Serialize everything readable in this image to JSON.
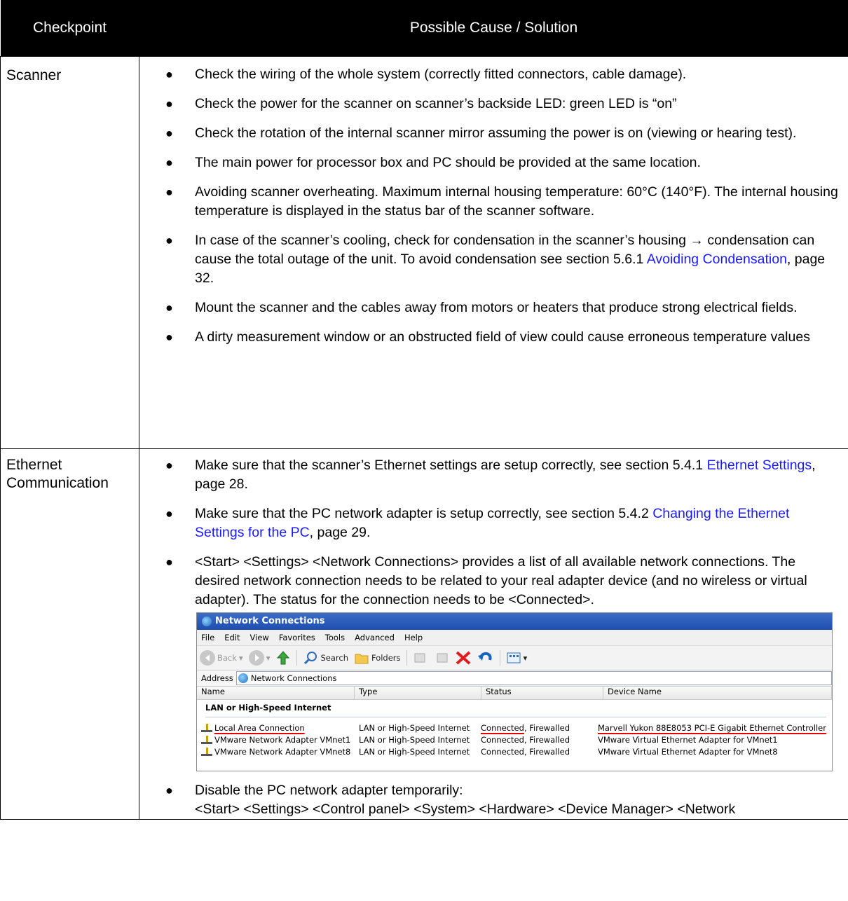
{
  "table": {
    "headers": {
      "checkpoint": "Checkpoint",
      "solution": "Possible Cause / Solution"
    },
    "scanner": {
      "label": "Scanner",
      "bullets": [
        "Check the wiring of the whole system (correctly fitted connectors, cable damage).",
        "Check the power for the scanner on scanner’s backside LED: green LED is “on”",
        "Check the rotation of the internal scanner mirror assuming the power is on (viewing or hearing test).",
        "The main power for processor box and PC should be provided at the same location.",
        "Avoiding scanner overheating. Maximum internal housing temperature: 60°C (140°F). The internal housing temperature is displayed in the status bar of the scanner software."
      ],
      "condensation": {
        "pre": "In case of the scanner’s cooling, check for condensation in the scanner’s housing → condensation can cause the total outage of the unit. To avoid condensation see section 5.6.1 ",
        "link": "Avoiding Condensation",
        "post": ", page 32."
      },
      "bullets2": [
        "Mount the scanner and the cables away from motors or heaters that produce strong electrical fields.",
        "A dirty measurement window or an obstructed field of view could cause erroneous temperature values"
      ]
    },
    "ethernet": {
      "label": "Ethernet Communication",
      "b1": {
        "pre": "Make sure that the scanner’s Ethernet settings are setup correctly, see section 5.4.1 ",
        "link": "Ethernet Settings",
        "post": ", page 28."
      },
      "b2": {
        "pre": "Make sure that the PC network adapter is setup correctly, see section 5.4.2 ",
        "link": "Changing the Ethernet Settings for the PC",
        "post": ", page 29."
      },
      "b3": "<Start> <Settings> <Network Connections> provides a list of all available network connections. The desired network connection needs to be related to your real adapter device (and no wireless or virtual adapter). The status for the connection needs to be <Connected>.",
      "b4_line1": "Disable the PC network adapter temporarily:",
      "b4_line2": "<Start> <Settings> <Control panel> <System> <Hardware> <Device Manager> <Network"
    }
  },
  "screenshot": {
    "title": "Network Connections",
    "menu": [
      "File",
      "Edit",
      "View",
      "Favorites",
      "Tools",
      "Advanced",
      "Help"
    ],
    "toolbar": {
      "back": "Back",
      "search": "Search",
      "folders": "Folders"
    },
    "address_label": "Address",
    "address_value": "Network Connections",
    "columns": [
      "Name",
      "Type",
      "Status",
      "Device Name"
    ],
    "group": "LAN or High-Speed Internet",
    "rows": [
      {
        "name": "Local Area Connection",
        "type": "LAN or High-Speed Internet",
        "status_a": "Connected",
        "status_b": ", Firewalled",
        "device": "Marvell Yukon 88E8053 PCI-E Gigabit Ethernet Controller"
      },
      {
        "name": "VMware Network Adapter VMnet1",
        "type": "LAN or High-Speed Internet",
        "status_a": "Connected",
        "status_b": ", Firewalled",
        "device": "VMware Virtual Ethernet Adapter for VMnet1"
      },
      {
        "name": "VMware Network Adapter VMnet8",
        "type": "LAN or High-Speed Internet",
        "status_a": "Connected",
        "status_b": ", Firewalled",
        "device": "VMware Virtual Ethernet Adapter for VMnet8"
      }
    ]
  }
}
